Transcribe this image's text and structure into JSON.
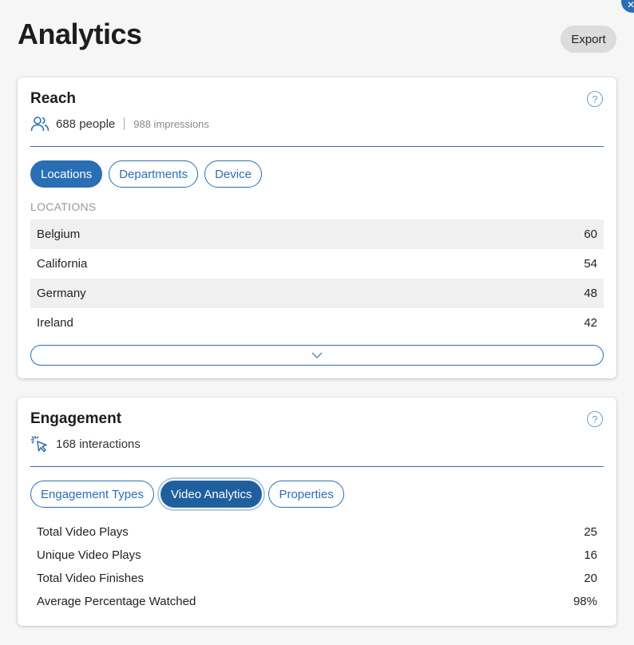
{
  "page": {
    "title": "Analytics",
    "export_label": "Export"
  },
  "reach": {
    "title": "Reach",
    "people": "688 people",
    "impressions": "988 impressions",
    "tabs": [
      {
        "label": "Locations",
        "active": true
      },
      {
        "label": "Departments",
        "active": false
      },
      {
        "label": "Device",
        "active": false
      }
    ],
    "section_label": "LOCATIONS",
    "rows": [
      {
        "name": "Belgium",
        "value": "60"
      },
      {
        "name": "California",
        "value": "54"
      },
      {
        "name": "Germany",
        "value": "48"
      },
      {
        "name": "Ireland",
        "value": "42"
      }
    ]
  },
  "engagement": {
    "title": "Engagement",
    "interactions": "168 interactions",
    "tabs": [
      {
        "label": "Engagement Types",
        "active": false
      },
      {
        "label": "Video Analytics",
        "active": true
      },
      {
        "label": "Properties",
        "active": false
      }
    ],
    "rows": [
      {
        "name": "Total Video Plays",
        "value": "25"
      },
      {
        "name": "Unique Video Plays",
        "value": "16"
      },
      {
        "name": "Total Video Finishes",
        "value": "20"
      },
      {
        "name": "Average Percentage Watched",
        "value": "98%"
      }
    ]
  },
  "icons": {
    "help": "question-circle-icon",
    "people": "people-icon",
    "interactions": "cursor-click-icon",
    "expand": "chevron-down-icon"
  },
  "colors": {
    "accent": "#2a6fb5",
    "accent_dark": "#1f5f9e",
    "background": "#f6f6f6"
  }
}
